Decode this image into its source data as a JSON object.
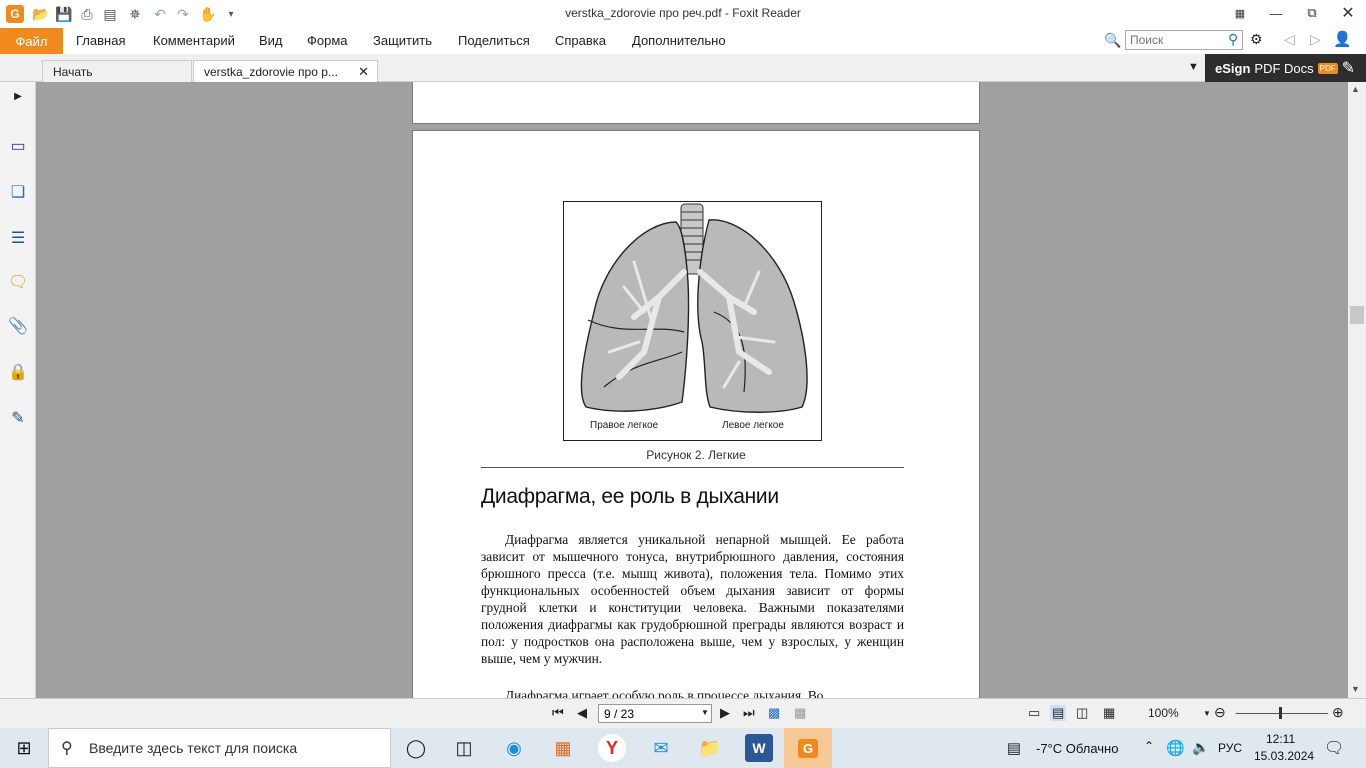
{
  "window": {
    "title": "verstka_zdorovie про реч.pdf - Foxit Reader"
  },
  "menu": {
    "file": "Файл",
    "items": [
      "Главная",
      "Комментарий",
      "Вид",
      "Форма",
      "Защитить",
      "Поделиться",
      "Справка",
      "Дополнительно"
    ],
    "search_placeholder": "Поиск"
  },
  "tabs": {
    "start": "Начать",
    "doc": "verstka_zdorovie про р...",
    "esign_bold": "eSign",
    "esign_rest": "PDF Docs",
    "esign_badge": "PDF"
  },
  "page": {
    "figure_left_label": "Правое легкое",
    "figure_right_label": "Левое легкое",
    "figure_caption": "Рисунок 2. Легкие",
    "heading": "Диафрагма, ее роль в дыхании",
    "paragraph1": "Диафрагма является уникальной непарной мышцей. Ее работа зависит от мышечного тонуса, внутрибрюшного давления, состояния брюшного пресса (т.е. мышц живота), положения тела. Помимо этих функциональных особенностей объем дыхания зависит от формы грудной клетки и конституции человека. Важными показателями положения диафрагмы как грудобрюшной преграды являются возраст и пол: у подростков она расположена выше, чем у взрослых, у женщин выше, чем у мужчин.",
    "paragraph2": "Диафрагма играет особую роль в процессе дыхания. Во"
  },
  "statusbar": {
    "page_indicator": "9 / 23",
    "zoom": "100%"
  },
  "taskbar": {
    "search_placeholder": "Введите здесь текст для поиска",
    "weather": "-7°C  Облачно",
    "lang": "РУС",
    "time": "12:11",
    "date": "15.03.2024"
  },
  "colors": {
    "accent": "#f08a1c",
    "esign_bg": "#2d2d2d"
  }
}
